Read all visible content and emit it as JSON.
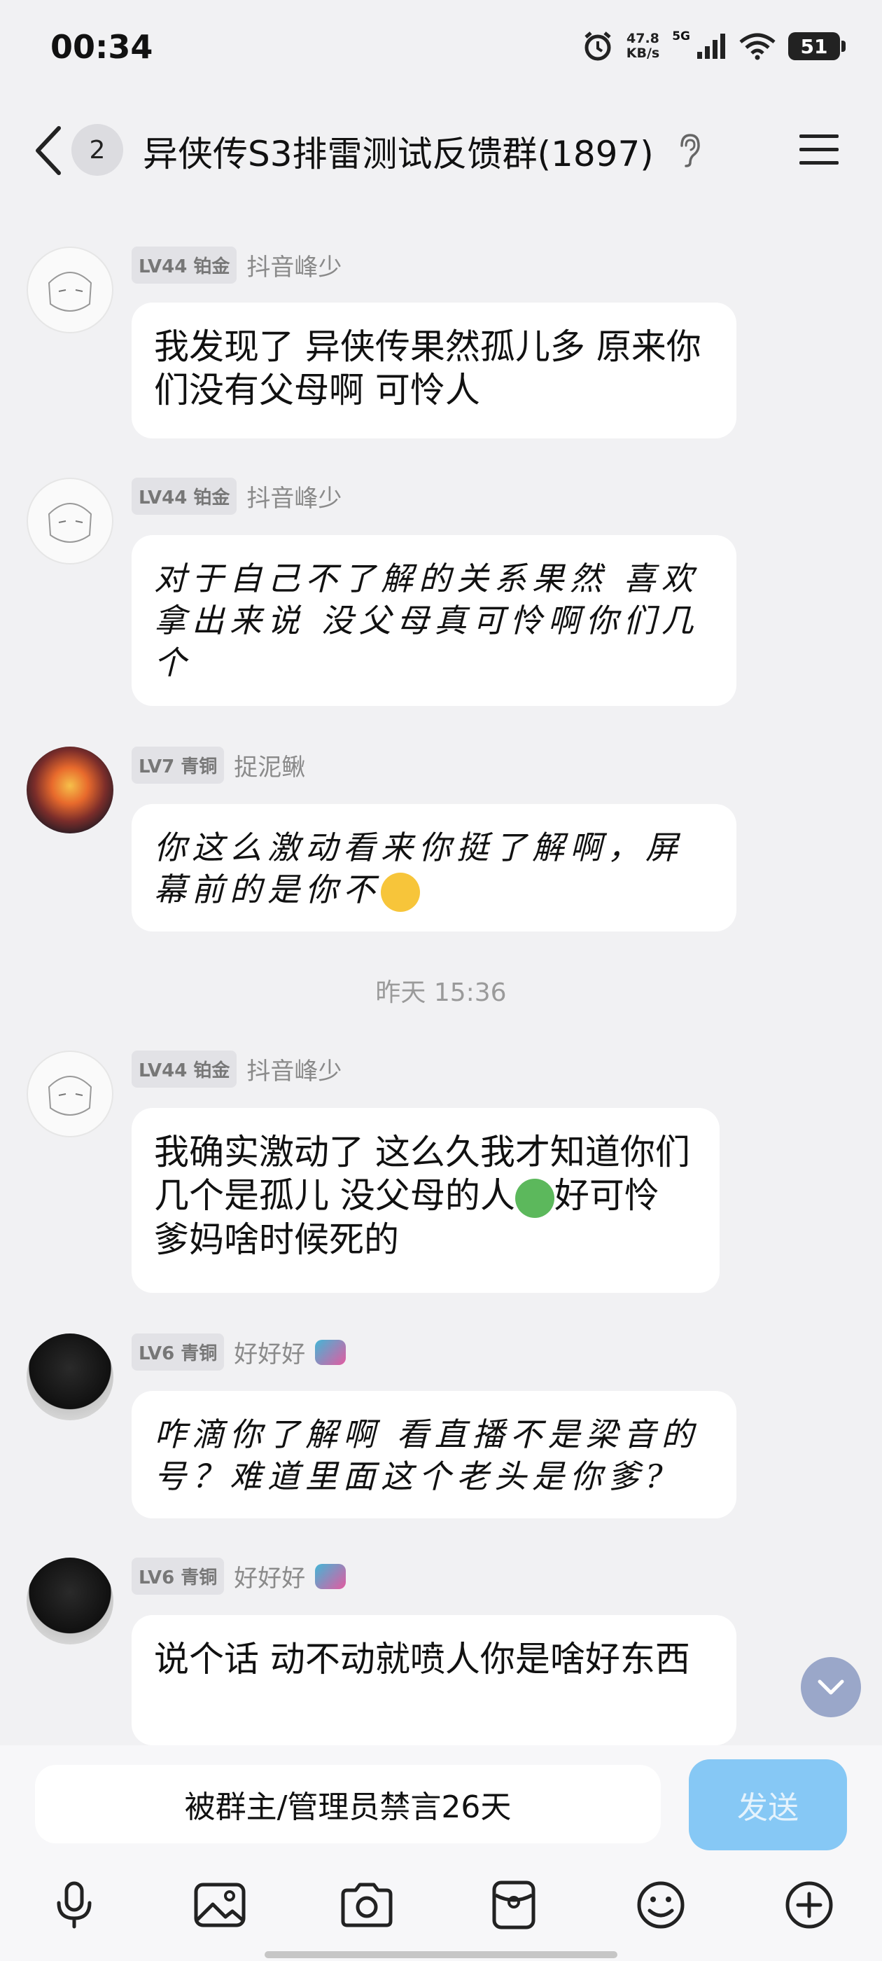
{
  "status_bar": {
    "time": "00:34",
    "net_speed_value": "47.8",
    "net_speed_unit": "KB/s",
    "network": "5G",
    "battery": "51"
  },
  "header": {
    "unread_count": "2",
    "title": "异侠传S3排雷测试反馈群(1897)"
  },
  "messages": [
    {
      "level": "LV44 铂金",
      "nickname": "抖音峰少",
      "text": "我发现了 异侠传果然孤儿多  原来你们没有父母啊 可怜人"
    },
    {
      "level": "LV44 铂金",
      "nickname": "抖音峰少",
      "text": "对于自己不了解的关系果然 喜欢拿出来说  没父母真可怜啊你们几个"
    },
    {
      "level": "LV7 青铜",
      "nickname": "捉泥鳅",
      "text": "你这么激动看来你挺了解啊，屏幕前的是你不"
    },
    {
      "level": "LV44 铂金",
      "nickname": "抖音峰少",
      "text_a": "我确实激动了  这么久我才知道你们几个是孤儿    没父母的人",
      "text_b": "好可怜    爹妈啥时候死的"
    },
    {
      "level": "LV6 青铜",
      "nickname": "好好好",
      "text": "咋滴你了解啊  看直播不是梁音的号？难道里面这个老头是你爹?"
    },
    {
      "level": "LV6 青铜",
      "nickname": "好好好",
      "text": "说个话 动不动就喷人你是啥好东西"
    }
  ],
  "time_separator": "昨天 15:36",
  "input": {
    "muted_text": "被群主/管理员禁言26天",
    "send_label": "发送"
  },
  "toolbar_icons": [
    "microphone-icon",
    "image-icon",
    "camera-icon",
    "red-packet-icon",
    "emoji-icon",
    "plus-icon"
  ],
  "colors": {
    "send_button": "#86c8f5",
    "background": "#f1f1f3",
    "bubble": "#ffffff"
  }
}
